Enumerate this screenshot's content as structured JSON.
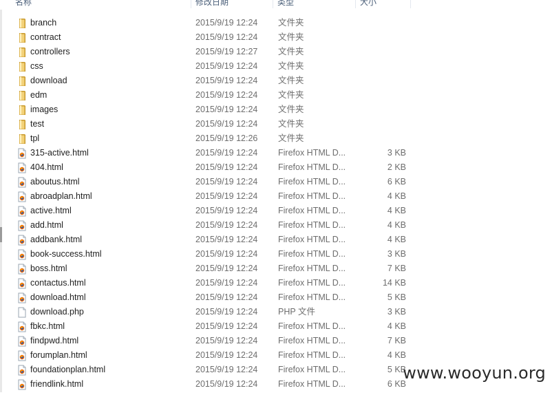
{
  "columns": {
    "name": "名称",
    "date": "修改日期",
    "type": "类型",
    "size": "大小"
  },
  "files": [
    {
      "name": "branch",
      "date": "2015/9/19 12:24",
      "type": "文件夹",
      "size": "",
      "icon": "folder-icon"
    },
    {
      "name": "contract",
      "date": "2015/9/19 12:24",
      "type": "文件夹",
      "size": "",
      "icon": "folder-icon"
    },
    {
      "name": "controllers",
      "date": "2015/9/19 12:27",
      "type": "文件夹",
      "size": "",
      "icon": "folder-icon"
    },
    {
      "name": "css",
      "date": "2015/9/19 12:24",
      "type": "文件夹",
      "size": "",
      "icon": "folder-icon"
    },
    {
      "name": "download",
      "date": "2015/9/19 12:24",
      "type": "文件夹",
      "size": "",
      "icon": "folder-icon"
    },
    {
      "name": "edm",
      "date": "2015/9/19 12:24",
      "type": "文件夹",
      "size": "",
      "icon": "folder-icon"
    },
    {
      "name": "images",
      "date": "2015/9/19 12:24",
      "type": "文件夹",
      "size": "",
      "icon": "folder-icon"
    },
    {
      "name": "test",
      "date": "2015/9/19 12:24",
      "type": "文件夹",
      "size": "",
      "icon": "folder-icon"
    },
    {
      "name": "tpl",
      "date": "2015/9/19 12:26",
      "type": "文件夹",
      "size": "",
      "icon": "folder-icon"
    },
    {
      "name": "315-active.html",
      "date": "2015/9/19 12:24",
      "type": "Firefox HTML D...",
      "size": "3 KB",
      "icon": "firefox-html-icon"
    },
    {
      "name": "404.html",
      "date": "2015/9/19 12:24",
      "type": "Firefox HTML D...",
      "size": "2 KB",
      "icon": "firefox-html-icon"
    },
    {
      "name": "aboutus.html",
      "date": "2015/9/19 12:24",
      "type": "Firefox HTML D...",
      "size": "6 KB",
      "icon": "firefox-html-icon"
    },
    {
      "name": "abroadplan.html",
      "date": "2015/9/19 12:24",
      "type": "Firefox HTML D...",
      "size": "4 KB",
      "icon": "firefox-html-icon"
    },
    {
      "name": "active.html",
      "date": "2015/9/19 12:24",
      "type": "Firefox HTML D...",
      "size": "4 KB",
      "icon": "firefox-html-icon"
    },
    {
      "name": "add.html",
      "date": "2015/9/19 12:24",
      "type": "Firefox HTML D...",
      "size": "4 KB",
      "icon": "firefox-html-icon"
    },
    {
      "name": "addbank.html",
      "date": "2015/9/19 12:24",
      "type": "Firefox HTML D...",
      "size": "4 KB",
      "icon": "firefox-html-icon"
    },
    {
      "name": "book-success.html",
      "date": "2015/9/19 12:24",
      "type": "Firefox HTML D...",
      "size": "3 KB",
      "icon": "firefox-html-icon"
    },
    {
      "name": "boss.html",
      "date": "2015/9/19 12:24",
      "type": "Firefox HTML D...",
      "size": "7 KB",
      "icon": "firefox-html-icon"
    },
    {
      "name": "contactus.html",
      "date": "2015/9/19 12:24",
      "type": "Firefox HTML D...",
      "size": "14 KB",
      "icon": "firefox-html-icon"
    },
    {
      "name": "download.html",
      "date": "2015/9/19 12:24",
      "type": "Firefox HTML D...",
      "size": "5 KB",
      "icon": "firefox-html-icon"
    },
    {
      "name": "download.php",
      "date": "2015/9/19 12:24",
      "type": "PHP 文件",
      "size": "3 KB",
      "icon": "blank-file-icon"
    },
    {
      "name": "fbkc.html",
      "date": "2015/9/19 12:24",
      "type": "Firefox HTML D...",
      "size": "4 KB",
      "icon": "firefox-html-icon"
    },
    {
      "name": "findpwd.html",
      "date": "2015/9/19 12:24",
      "type": "Firefox HTML D...",
      "size": "7 KB",
      "icon": "firefox-html-icon"
    },
    {
      "name": "forumplan.html",
      "date": "2015/9/19 12:24",
      "type": "Firefox HTML D...",
      "size": "4 KB",
      "icon": "firefox-html-icon"
    },
    {
      "name": "foundationplan.html",
      "date": "2015/9/19 12:24",
      "type": "Firefox HTML D...",
      "size": "5 KB",
      "icon": "firefox-html-icon"
    },
    {
      "name": "friendlink.html",
      "date": "2015/9/19 12:24",
      "type": "Firefox HTML D...",
      "size": "6 KB",
      "icon": "firefox-html-icon"
    }
  ],
  "watermark": "www.wooyun.org",
  "colors": {
    "header_text": "#4c607a",
    "secondary_text": "#6d6d6d",
    "folder": "#e8c35a",
    "firefox": "#e66000"
  }
}
